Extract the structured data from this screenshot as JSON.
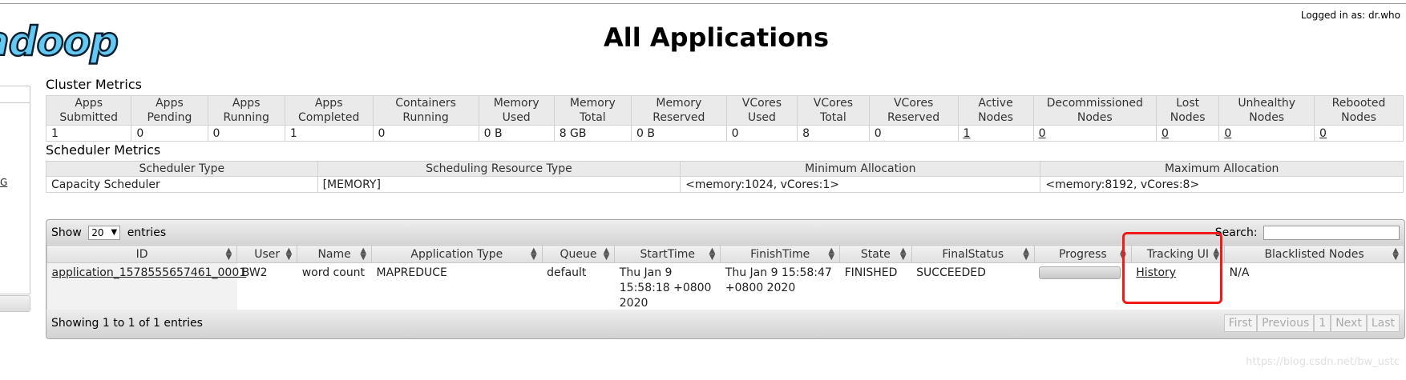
{
  "header": {
    "logged_in": "Logged in as: dr.who",
    "logo_text": "adoop",
    "title": "All Applications"
  },
  "left_nav": {
    "glyph": "G"
  },
  "cluster_metrics": {
    "title": "Cluster Metrics",
    "headers": [
      [
        "Apps",
        "Submitted"
      ],
      [
        "Apps",
        "Pending"
      ],
      [
        "Apps",
        "Running"
      ],
      [
        "Apps",
        "Completed"
      ],
      [
        "Containers",
        "Running"
      ],
      [
        "Memory",
        "Used"
      ],
      [
        "Memory",
        "Total"
      ],
      [
        "Memory",
        "Reserved"
      ],
      [
        "VCores",
        "Used"
      ],
      [
        "VCores",
        "Total"
      ],
      [
        "VCores",
        "Reserved"
      ],
      [
        "Active",
        "Nodes"
      ],
      [
        "Decommissioned",
        "Nodes"
      ],
      [
        "Lost",
        "Nodes"
      ],
      [
        "Unhealthy",
        "Nodes"
      ],
      [
        "Rebooted",
        "Nodes"
      ]
    ],
    "values": [
      "1",
      "0",
      "0",
      "1",
      "0",
      "0 B",
      "8 GB",
      "0 B",
      "0",
      "8",
      "0",
      "1",
      "0",
      "0",
      "0",
      "0"
    ],
    "links": [
      false,
      false,
      false,
      false,
      false,
      false,
      false,
      false,
      false,
      false,
      false,
      true,
      true,
      true,
      true,
      true
    ]
  },
  "scheduler_metrics": {
    "title": "Scheduler Metrics",
    "headers": [
      "Scheduler Type",
      "Scheduling Resource Type",
      "Minimum Allocation",
      "Maximum Allocation"
    ],
    "values": [
      "Capacity Scheduler",
      "[MEMORY]",
      "<memory:1024, vCores:1>",
      "<memory:8192, vCores:8>"
    ]
  },
  "apps_table": {
    "show_label": "Show",
    "page_size": "20",
    "entries_label": "entries",
    "search_label": "Search:",
    "search_value": "",
    "columns": [
      "ID",
      "User",
      "Name",
      "Application Type",
      "Queue",
      "StartTime",
      "FinishTime",
      "State",
      "FinalStatus",
      "Progress",
      "Tracking UI",
      "Blacklisted Nodes"
    ],
    "rows": [
      {
        "id": "application_1578555657461_0001",
        "user": "BW2",
        "name": "word count",
        "type": "MAPREDUCE",
        "queue": "default",
        "start": "Thu Jan 9 15:58:18 +0800 2020",
        "finish": "Thu Jan 9 15:58:47 +0800 2020",
        "state": "FINISHED",
        "final_status": "SUCCEEDED",
        "progress": 1.0,
        "tracking_ui": "History",
        "blacklisted": "N/A"
      }
    ],
    "showing": "Showing 1 to 1 of 1 entries",
    "pager": [
      "First",
      "Previous",
      "1",
      "Next",
      "Last"
    ]
  },
  "watermark": "https://blog.csdn.net/bw_ustc",
  "colors": {
    "highlight": "#ef1a1a",
    "logo": "#64c8f0"
  }
}
